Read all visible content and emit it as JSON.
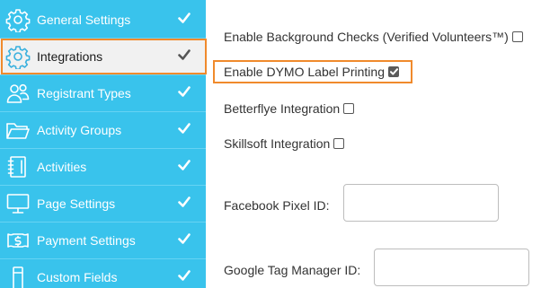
{
  "sidebar": {
    "items": [
      {
        "label": "General Settings",
        "icon": "gear-icon",
        "checked": true,
        "active": false
      },
      {
        "label": "Integrations",
        "icon": "gear-icon",
        "checked": true,
        "active": true
      },
      {
        "label": "Registrant Types",
        "icon": "people-icon",
        "checked": true,
        "active": false
      },
      {
        "label": "Activity Groups",
        "icon": "folder-icon",
        "checked": true,
        "active": false
      },
      {
        "label": "Activities",
        "icon": "notebook-icon",
        "checked": true,
        "active": false
      },
      {
        "label": "Page Settings",
        "icon": "monitor-icon",
        "checked": true,
        "active": false
      },
      {
        "label": "Payment Settings",
        "icon": "dollar-bill-icon",
        "checked": true,
        "active": false
      },
      {
        "label": "Custom Fields",
        "icon": "pencil-icon",
        "checked": true,
        "active": false
      }
    ]
  },
  "main": {
    "options": [
      {
        "label": "Enable Background Checks (Verified Volunteers™)",
        "checked": false
      },
      {
        "label": "Enable DYMO Label Printing",
        "checked": true
      },
      {
        "label": "Betterflye Integration",
        "checked": false
      },
      {
        "label": "Skillsoft Integration",
        "checked": false
      }
    ],
    "fields": [
      {
        "label": "Facebook Pixel ID:",
        "value": "",
        "placeholder": ""
      },
      {
        "label": "Google Tag Manager ID:",
        "value": "",
        "placeholder": ""
      }
    ]
  },
  "colors": {
    "sidebar_bg": "#39c3ec",
    "highlight": "#f08a2c",
    "active_bg": "#f1f1f1"
  }
}
